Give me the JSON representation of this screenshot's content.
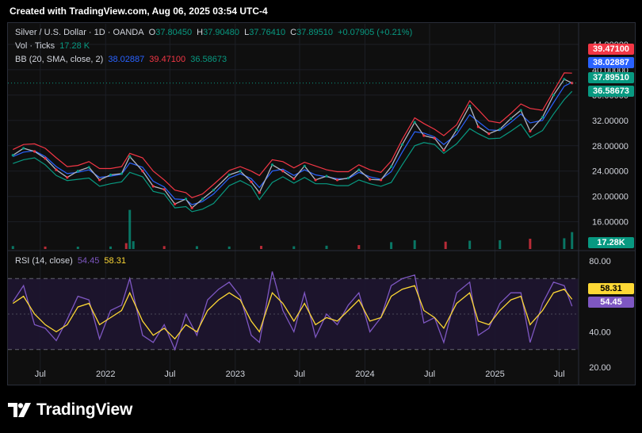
{
  "header": {
    "credit": "Created with TradingView.com, Aug 06, 2025 03:54 UTC-4"
  },
  "legend": {
    "symbol": "Silver / U.S. Dollar · 1D · OANDA",
    "o_label": "O",
    "o": "37.80450",
    "h_label": "H",
    "h": "37.90480",
    "l_label": "L",
    "l": "37.76410",
    "c_label": "C",
    "c": "37.89510",
    "change": "+0.07905 (+0.21%)",
    "vol_label": "Vol · Ticks",
    "vol": "17.28 K",
    "bb_label": "BB (20, SMA, close, 2)",
    "bb_basis": "38.02887",
    "bb_upper": "39.47100",
    "bb_lower": "36.58673",
    "rsi_label": "RSI (14, close)",
    "rsi": "54.45",
    "rsi_ma": "58.31"
  },
  "price_labels": {
    "upper": "39.47100",
    "basis": "38.02887",
    "close": "37.89510",
    "lower": "36.58673",
    "volume": "17.28K",
    "rsi_ma": "58.31",
    "rsi": "54.45"
  },
  "colors": {
    "upper": "#f23645",
    "basis": "#2962ff",
    "close": "#089981",
    "lower": "#089981",
    "rsi": "#7e57c2",
    "rsi_ma": "#fdd835",
    "vol": "#089981",
    "bg": "#0f0f0f",
    "rsi_band": "#1e1530"
  },
  "footer": {
    "brand": "TradingView"
  },
  "chart_data": [
    {
      "type": "line",
      "title": "Silver / U.S. Dollar · 1D · OANDA",
      "x_ticks": [
        "Jul",
        "2022",
        "Jul",
        "2023",
        "Jul",
        "2024",
        "Jul",
        "2025",
        "Jul"
      ],
      "x_tick_dates": [
        "2021-07-01",
        "2022-01-01",
        "2022-07-01",
        "2023-01-01",
        "2023-07-01",
        "2024-01-01",
        "2024-07-01",
        "2025-01-01",
        "2025-07-01"
      ],
      "y_ticks": [
        16,
        20,
        24,
        28,
        32,
        36,
        40,
        44
      ],
      "y_tick_labels": [
        "16.00000",
        "20.00000",
        "24.00000",
        "28.00000",
        "32.00000",
        "36.00000",
        "40.00000",
        "44.00000"
      ],
      "ylim": [
        12.2,
        46.0
      ],
      "dates": [
        "2021-04-15",
        "2021-05-15",
        "2021-06-15",
        "2021-07-15",
        "2021-08-15",
        "2021-09-15",
        "2021-10-15",
        "2021-11-15",
        "2021-12-15",
        "2022-01-15",
        "2022-02-15",
        "2022-03-10",
        "2022-04-15",
        "2022-05-15",
        "2022-06-15",
        "2022-07-15",
        "2022-08-15",
        "2022-09-01",
        "2022-10-01",
        "2022-11-01",
        "2022-12-15",
        "2023-01-15",
        "2023-02-15",
        "2023-03-10",
        "2023-04-15",
        "2023-05-15",
        "2023-06-15",
        "2023-07-15",
        "2023-08-15",
        "2023-09-15",
        "2023-10-15",
        "2023-11-15",
        "2023-12-15",
        "2024-01-15",
        "2024-02-15",
        "2024-03-15",
        "2024-04-15",
        "2024-05-20",
        "2024-06-15",
        "2024-07-15",
        "2024-08-10",
        "2024-09-15",
        "2024-10-22",
        "2024-11-15",
        "2024-12-15",
        "2025-01-15",
        "2025-02-15",
        "2025-03-15",
        "2025-04-10",
        "2025-05-15",
        "2025-06-15",
        "2025-07-15",
        "2025-08-06"
      ],
      "series": [
        {
          "name": "Silver / U.S. Dollar",
          "values": [
            26.5,
            27.6,
            27.1,
            26.0,
            24.2,
            23.0,
            24.0,
            24.6,
            22.6,
            23.4,
            23.6,
            26.3,
            24.0,
            21.6,
            21.1,
            18.8,
            19.6,
            18.2,
            19.6,
            21.0,
            23.4,
            24.0,
            22.3,
            20.6,
            25.0,
            24.0,
            22.8,
            24.8,
            22.6,
            23.2,
            22.6,
            22.9,
            24.2,
            22.7,
            22.6,
            24.7,
            28.2,
            31.7,
            29.6,
            29.2,
            27.3,
            30.5,
            34.3,
            31.0,
            29.9,
            30.6,
            32.3,
            33.6,
            30.3,
            32.5,
            36.0,
            38.5,
            37.9
          ]
        },
        {
          "name": "BB (20, SMA, close, 2) basis",
          "values": [
            26.3,
            27.0,
            27.2,
            26.3,
            24.7,
            23.6,
            23.8,
            24.2,
            23.0,
            23.2,
            23.5,
            25.3,
            24.6,
            22.4,
            21.5,
            19.6,
            19.5,
            18.7,
            19.2,
            20.4,
            22.9,
            23.6,
            22.8,
            21.4,
            24.0,
            24.3,
            23.3,
            24.2,
            23.4,
            23.1,
            22.8,
            22.8,
            23.8,
            23.1,
            22.7,
            23.9,
            27.0,
            30.2,
            30.0,
            29.4,
            28.2,
            29.8,
            32.9,
            31.8,
            30.5,
            30.4,
            31.7,
            33.0,
            31.6,
            32.0,
            34.8,
            37.4,
            38.03
          ]
        },
        {
          "name": "BB (20, SMA, close, 2) upper",
          "values": [
            27.4,
            28.2,
            28.3,
            27.6,
            26.1,
            24.7,
            24.9,
            25.5,
            24.4,
            24.4,
            24.7,
            26.8,
            26.1,
            24.0,
            22.6,
            21.0,
            20.6,
            19.8,
            20.4,
            21.9,
            24.1,
            24.7,
            24.0,
            23.3,
            25.8,
            25.5,
            24.5,
            25.4,
            24.8,
            24.2,
            23.9,
            23.9,
            25.0,
            24.2,
            23.8,
            25.6,
            29.0,
            32.4,
            31.5,
            30.6,
            29.6,
            31.3,
            35.1,
            33.7,
            31.9,
            31.6,
            33.1,
            34.6,
            33.9,
            33.6,
            36.6,
            39.5,
            39.47
          ]
        },
        {
          "name": "BB (20, SMA, close, 2) lower",
          "values": [
            25.2,
            25.8,
            26.1,
            25.0,
            23.3,
            22.5,
            22.7,
            22.9,
            21.6,
            22.0,
            22.3,
            23.8,
            23.1,
            20.8,
            20.4,
            18.2,
            18.4,
            17.6,
            18.0,
            18.9,
            21.7,
            22.5,
            21.6,
            19.5,
            22.2,
            23.1,
            22.1,
            23.0,
            22.0,
            22.0,
            21.7,
            21.7,
            22.6,
            22.0,
            21.6,
            22.2,
            25.0,
            28.0,
            28.5,
            28.2,
            26.8,
            28.3,
            30.7,
            29.9,
            29.1,
            29.2,
            30.3,
            31.4,
            29.3,
            30.4,
            33.0,
            35.3,
            36.59
          ]
        }
      ]
    },
    {
      "type": "bar",
      "title": "Vol · Ticks",
      "x_ticks": [
        "Jul",
        "2022",
        "Jul",
        "2023",
        "Jul",
        "2024",
        "Jul",
        "2025",
        "Jul"
      ],
      "dates": [
        "2021-04-15",
        "2021-07-15",
        "2021-10-15",
        "2022-01-15",
        "2022-02-28",
        "2022-03-10",
        "2022-03-20",
        "2022-06-15",
        "2022-09-15",
        "2022-12-15",
        "2023-03-15",
        "2023-06-15",
        "2023-09-15",
        "2023-12-15",
        "2024-03-15",
        "2024-05-20",
        "2024-08-15",
        "2024-10-22",
        "2025-01-15",
        "2025-04-10",
        "2025-07-15",
        "2025-08-06"
      ],
      "series": [
        {
          "name": "Vol · Ticks",
          "values": [
            3.0,
            2.5,
            2.4,
            2.6,
            6.0,
            40.0,
            8.0,
            3.0,
            2.9,
            2.6,
            3.2,
            2.8,
            3.4,
            4.0,
            7.0,
            9.0,
            7.5,
            8.5,
            9.0,
            10.5,
            11.0,
            17.28
          ]
        }
      ],
      "ylim": [
        0,
        60
      ]
    },
    {
      "type": "line",
      "title": "RSI (14, close)",
      "x_ticks": [
        "Jul",
        "2022",
        "Jul",
        "2023",
        "Jul",
        "2024",
        "Jul",
        "2025",
        "Jul"
      ],
      "y_ticks": [
        20,
        40,
        80
      ],
      "y_tick_labels": [
        "20.00",
        "40.00",
        "80.00"
      ],
      "bands": [
        30,
        70
      ],
      "ylim": [
        16,
        84
      ],
      "dates": [
        "2021-04-15",
        "2021-05-15",
        "2021-06-15",
        "2021-07-15",
        "2021-08-15",
        "2021-09-15",
        "2021-10-15",
        "2021-11-15",
        "2021-12-15",
        "2022-01-15",
        "2022-02-15",
        "2022-03-10",
        "2022-04-15",
        "2022-05-15",
        "2022-06-15",
        "2022-07-15",
        "2022-08-15",
        "2022-09-15",
        "2022-10-15",
        "2022-11-15",
        "2022-12-15",
        "2023-01-15",
        "2023-02-15",
        "2023-03-10",
        "2023-04-15",
        "2023-05-15",
        "2023-06-15",
        "2023-07-15",
        "2023-08-15",
        "2023-09-15",
        "2023-10-15",
        "2023-11-15",
        "2023-12-15",
        "2024-01-15",
        "2024-02-15",
        "2024-03-15",
        "2024-04-15",
        "2024-05-20",
        "2024-06-15",
        "2024-07-15",
        "2024-08-10",
        "2024-09-15",
        "2024-10-22",
        "2024-11-15",
        "2024-12-15",
        "2025-01-15",
        "2025-02-15",
        "2025-03-15",
        "2025-04-10",
        "2025-05-15",
        "2025-06-15",
        "2025-07-15",
        "2025-08-06"
      ],
      "series": [
        {
          "name": "RSI",
          "values": [
            57,
            66,
            44,
            42,
            35,
            47,
            60,
            58,
            36,
            52,
            55,
            70,
            38,
            34,
            44,
            30,
            50,
            38,
            58,
            64,
            68,
            60,
            38,
            34,
            74,
            52,
            40,
            62,
            37,
            50,
            44,
            55,
            62,
            40,
            48,
            66,
            70,
            72,
            45,
            48,
            34,
            62,
            68,
            38,
            42,
            56,
            62,
            62,
            34,
            56,
            68,
            66,
            54.45
          ]
        },
        {
          "name": "RSI-based MA",
          "values": [
            56,
            60,
            50,
            44,
            40,
            44,
            54,
            56,
            44,
            48,
            52,
            62,
            46,
            38,
            42,
            36,
            44,
            40,
            52,
            58,
            62,
            58,
            46,
            40,
            62,
            56,
            46,
            56,
            44,
            48,
            46,
            52,
            58,
            46,
            48,
            60,
            64,
            66,
            52,
            48,
            42,
            56,
            62,
            46,
            44,
            52,
            58,
            60,
            44,
            52,
            62,
            64,
            58.31
          ]
        }
      ]
    }
  ]
}
